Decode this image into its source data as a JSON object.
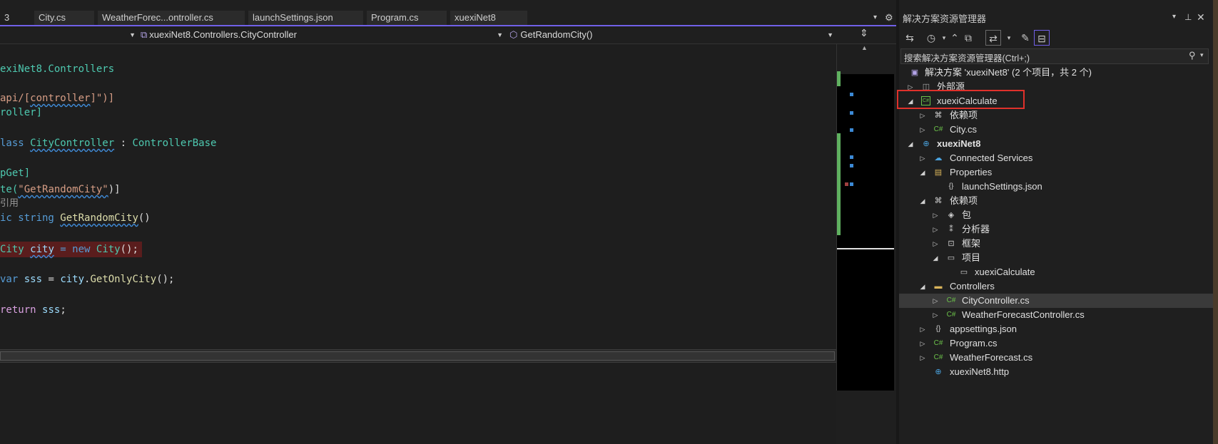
{
  "editor_tabs": [
    "3",
    "City.cs",
    "WeatherForec...ontroller.cs",
    "launchSettings.json",
    "Program.cs",
    "xuexiNet8"
  ],
  "nav": {
    "project_value": "",
    "class_value": "xuexiNet8.Controllers.CityController",
    "member_value": "GetRandomCity()"
  },
  "code": {
    "l1": "exiNet8.Controllers",
    "l2_a": "api/[",
    "l2_b": "controller",
    "l2_c": "]\")]",
    "l3": "roller]",
    "l4_a": "lass ",
    "l4_b": "CityController",
    "l4_c": " : ",
    "l4_d": "ControllerBase",
    "l5": "pGet]",
    "l6_a": "te(",
    "l6_b": "\"GetRandomCity\"",
    "l6_c": ")]",
    "codelens": "引用",
    "l7_a": "ic string ",
    "l7_b": "GetRandomCity",
    "l7_c": "()",
    "l8_a": "City ",
    "l8_b": "city",
    "l8_c": " = new ",
    "l8_d": "City",
    "l8_e": "();",
    "l9_a": "var ",
    "l9_b": "sss",
    "l9_c": " = ",
    "l9_d": "city",
    "l9_e": ".",
    "l9_f": "GetOnlyCity",
    "l9_g": "();",
    "l10_a": "return ",
    "l10_b": "sss",
    "l10_c": ";"
  },
  "solution_explorer": {
    "title": "解决方案资源管理器",
    "search_placeholder": "搜索解决方案资源管理器(Ctrl+;)",
    "tree": [
      {
        "label": "解决方案 'xuexiNet8' (2 个项目，共 2 个)"
      },
      {
        "label": "外部源"
      },
      {
        "label": "xuexiCalculate"
      },
      {
        "label": "依赖项"
      },
      {
        "label": "City.cs"
      },
      {
        "label": "xuexiNet8"
      },
      {
        "label": "Connected Services"
      },
      {
        "label": "Properties"
      },
      {
        "label": "launchSettings.json"
      },
      {
        "label": "依赖项"
      },
      {
        "label": "包"
      },
      {
        "label": "分析器"
      },
      {
        "label": "框架"
      },
      {
        "label": "项目"
      },
      {
        "label": "xuexiCalculate"
      },
      {
        "label": "Controllers"
      },
      {
        "label": "CityController.cs"
      },
      {
        "label": "WeatherForecastController.cs"
      },
      {
        "label": "appsettings.json"
      },
      {
        "label": "Program.cs"
      },
      {
        "label": "WeatherForecast.cs"
      },
      {
        "label": "xuexiNet8.http"
      }
    ]
  },
  "colors": {
    "accent": "#7160e8",
    "highlight_box": "#e0312b",
    "breakpoint_line": "#5a1d1d",
    "csharp_icon": "#6cc24a"
  }
}
